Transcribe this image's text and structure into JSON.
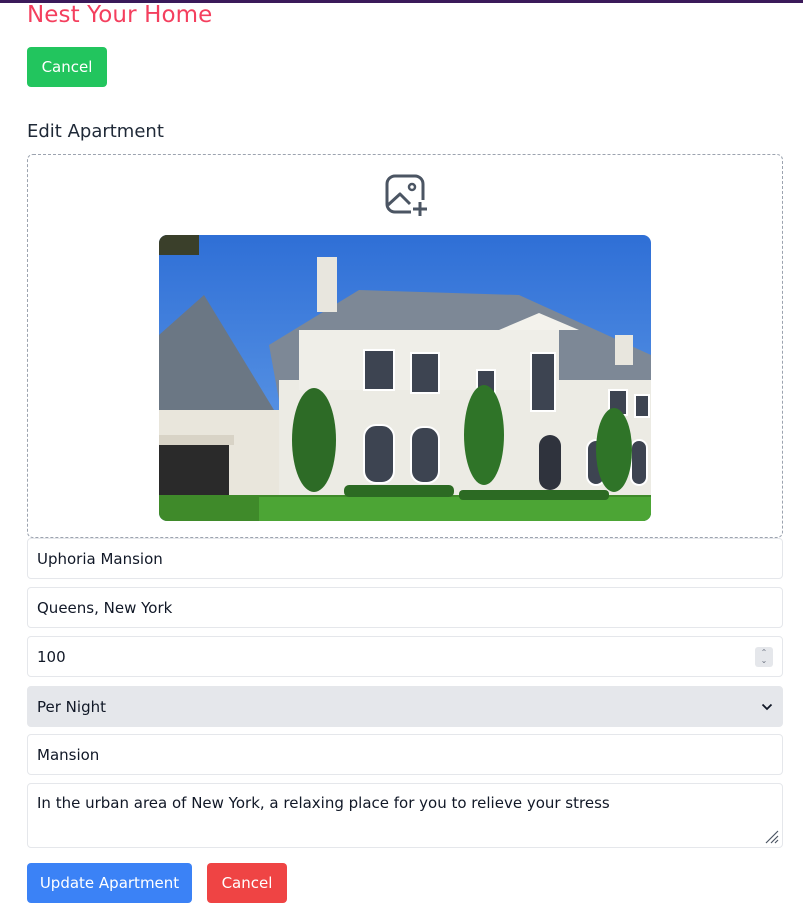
{
  "app": {
    "brand": "Nest Your Home"
  },
  "header": {
    "cancel_label": "Cancel"
  },
  "form": {
    "title": "Edit Apartment",
    "upload_icon": "image-add-icon",
    "photo": "mansion-photo",
    "name": "Uphoria Mansion",
    "location": "Queens, New York",
    "price": "100",
    "price_unit": "Per Night",
    "type": "Mansion",
    "description": "In the urban area of New York, a relaxing place for you to relieve your stress",
    "submit_label": "Update Apartment",
    "cancel_label": "Cancel"
  },
  "colors": {
    "brand": "#f43f5e",
    "green": "#22c55e",
    "blue": "#3b82f6",
    "red": "#ef4444"
  }
}
